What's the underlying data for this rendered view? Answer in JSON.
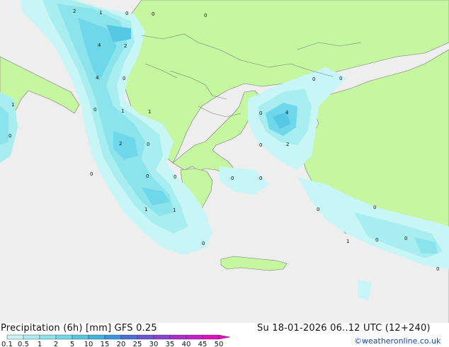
{
  "footer": {
    "title": "Precipitation (6h) [mm] GFS 0.25",
    "valid_time": "Su 18-01-2026 06..12 UTC (12+240)",
    "credit": "©weatheronline.co.uk"
  },
  "legend": {
    "ticks": [
      "0.1",
      "0.5",
      "1",
      "2",
      "5",
      "10",
      "15",
      "20",
      "25",
      "30",
      "35",
      "40",
      "45",
      "50"
    ],
    "colors": [
      "#c8f5f5",
      "#a8eef0",
      "#8be4ec",
      "#6ed8ea",
      "#55c8e6",
      "#3fb4e2",
      "#3b95dc",
      "#4a6fd6",
      "#6a55d4",
      "#8a40d0",
      "#aa2ecc",
      "#c81ec8",
      "#e010c0"
    ]
  },
  "map_colors": {
    "sea": "#eeeeee",
    "land": "#c5f7a0",
    "border": "#777777"
  },
  "contour_labels": [
    "2",
    "1",
    "0",
    "0",
    "0",
    "4",
    "2",
    "4",
    "0",
    "1",
    "0",
    "1",
    "1",
    "0",
    "2",
    "0",
    "0",
    "0",
    "0",
    "0",
    "1",
    "1",
    "0",
    "0",
    "0",
    "0",
    "4",
    "0",
    "2",
    "0",
    "0",
    "0",
    "1",
    "0",
    "0",
    "0"
  ]
}
